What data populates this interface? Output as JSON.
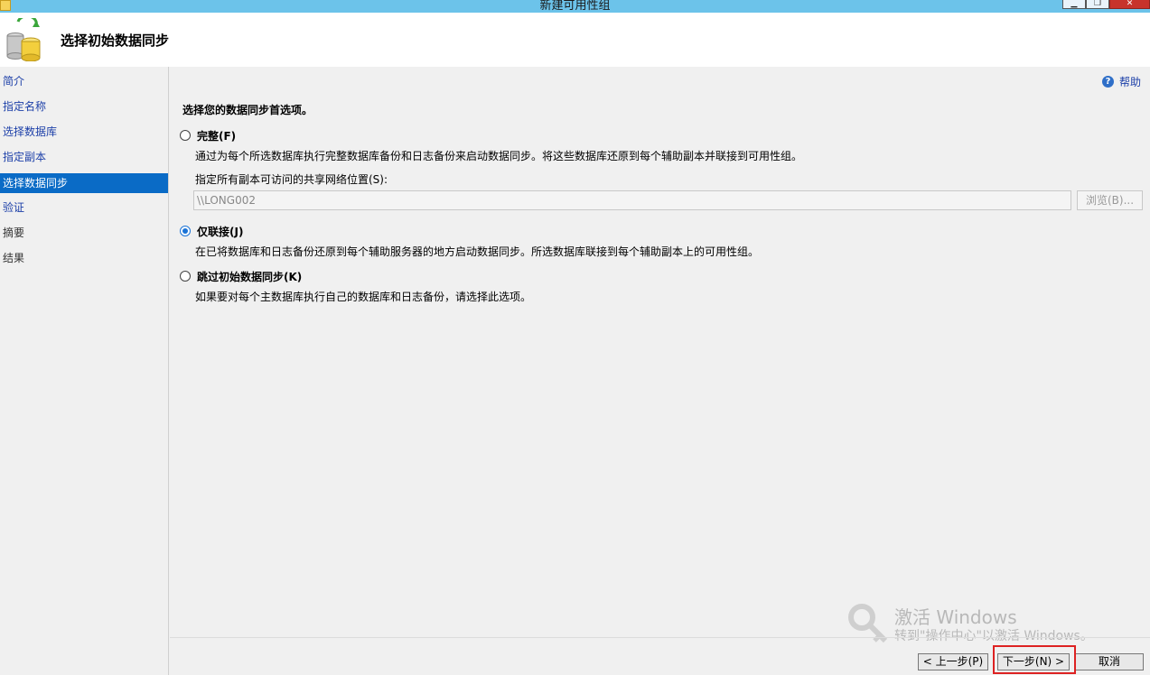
{
  "window": {
    "title": "新建可用性组",
    "min_glyph": "▁",
    "max_glyph": "❐",
    "close_glyph": "✕"
  },
  "header": {
    "title": "选择初始数据同步"
  },
  "sidebar": {
    "items": [
      {
        "label": "简介",
        "state": "link"
      },
      {
        "label": "指定名称",
        "state": "link"
      },
      {
        "label": "选择数据库",
        "state": "link"
      },
      {
        "label": "指定副本",
        "state": "link"
      },
      {
        "label": "选择数据同步",
        "state": "active"
      },
      {
        "label": "验证",
        "state": "link"
      },
      {
        "label": "摘要",
        "state": "plain"
      },
      {
        "label": "结果",
        "state": "plain"
      }
    ]
  },
  "main": {
    "help_label": "帮助",
    "help_icon": "?",
    "prompt": "选择您的数据同步首选项。",
    "options": [
      {
        "label": "完整(F)",
        "description": "通过为每个所选数据库执行完整数据库备份和日志备份来启动数据同步。将这些数据库还原到每个辅助副本并联接到可用性组。",
        "checked": false
      },
      {
        "label": "仅联接(J)",
        "description": "在已将数据库和日志备份还原到每个辅助服务器的地方启动数据同步。所选数据库联接到每个辅助副本上的可用性组。",
        "checked": true
      },
      {
        "label": "跳过初始数据同步(K)",
        "description": "如果要对每个主数据库执行自己的数据库和日志备份，请选择此选项。",
        "checked": false
      }
    ],
    "share_path_label": "指定所有副本可访问的共享网络位置(S):",
    "share_path_value": "\\\\LONG002",
    "browse_label": "浏览(B)..."
  },
  "watermark": {
    "title": "激活 Windows",
    "subtitle": "转到\"操作中心\"以激活 Windows。"
  },
  "footer": {
    "back_label": "< 上一步(P)",
    "next_label": "下一步(N) >",
    "cancel_label": "取消"
  },
  "colors": {
    "titlebar": "#6cc3ea",
    "active_nav": "#0a6bc6",
    "link": "#1c3fa8",
    "highlight": "#dd2222"
  }
}
